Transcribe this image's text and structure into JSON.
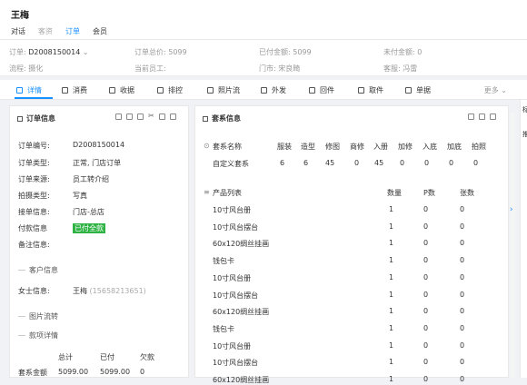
{
  "header": {
    "customer_name": "王梅",
    "tabs": [
      {
        "label": "对话",
        "state": "normal"
      },
      {
        "label": "客资",
        "state": "muted"
      },
      {
        "label": "订单",
        "state": "active"
      },
      {
        "label": "会员",
        "state": "normal"
      }
    ]
  },
  "order_info_bar": {
    "order_label": "订单:",
    "order_value": "D2008150014",
    "total_label": "订单总价:",
    "total_value": "5099",
    "paid_label": "已付金额:",
    "paid_value": "5099",
    "unpaid_label": "未付金额:",
    "unpaid_value": "0",
    "flow_label": "流程:",
    "flow_value": "摄化",
    "staff_label": "当前员工:",
    "staff_value": "",
    "store_label": "门市:",
    "store_value": "宋良畸",
    "service_label": "客服:",
    "service_value": "冯雷"
  },
  "actions": [
    "详情",
    "消费",
    "收据",
    "排控",
    "照片流",
    "外发",
    "回件",
    "取件",
    "单据"
  ],
  "more_label": "更多",
  "left_panel": {
    "title": "订单信息",
    "fields": [
      {
        "label": "订单编号:",
        "value": "D2008150014"
      },
      {
        "label": "订单类型:",
        "value": "正常, 门店订单"
      },
      {
        "label": "订单来源:",
        "value": "员工转介绍"
      },
      {
        "label": "拍摄类型:",
        "value": "写真"
      },
      {
        "label": "接单信息:",
        "value": "门店-总店"
      },
      {
        "label": "付款信息",
        "value": "已付全款"
      },
      {
        "label": "备注信息:",
        "value": ""
      }
    ],
    "section_customer": "客户信息",
    "customer_label": "女士信息:",
    "customer_name": "王梅",
    "customer_phone": "(15658213651)",
    "section_photo": "图片流转",
    "section_payment": "款项详情",
    "pay_headers": [
      "总计",
      "已付",
      "欠款"
    ],
    "pay_row_label": "套系金额",
    "pay_values": [
      "5099.00",
      "5099.00",
      "0"
    ]
  },
  "right_panel": {
    "title": "套系信息",
    "package_headers": [
      "套系名称",
      "服装",
      "造型",
      "修图",
      "商修",
      "入册",
      "加修",
      "入底",
      "加底",
      "拍照"
    ],
    "package_row": [
      "自定义套系",
      "6",
      "6",
      "45",
      "0",
      "45",
      "0",
      "0",
      "0",
      "0"
    ],
    "product_headers": [
      "产品列表",
      "数量",
      "P数",
      "张数"
    ],
    "products": [
      [
        "10寸风台册",
        "1",
        "0",
        "0"
      ],
      [
        "10寸风台摆台",
        "1",
        "0",
        "0"
      ],
      [
        "60x120绸丝挂画",
        "1",
        "0",
        "0"
      ],
      [
        "钱包卡",
        "1",
        "0",
        "0"
      ],
      [
        "10寸风台册",
        "1",
        "0",
        "0"
      ],
      [
        "10寸风台摆台",
        "1",
        "0",
        "0"
      ],
      [
        "60x120绸丝挂画",
        "1",
        "0",
        "0"
      ],
      [
        "钱包卡",
        "1",
        "0",
        "0"
      ],
      [
        "10寸风台册",
        "1",
        "0",
        "0"
      ],
      [
        "10寸风台摆台",
        "1",
        "0",
        "0"
      ],
      [
        "60x120绸丝挂画",
        "1",
        "0",
        "0"
      ]
    ]
  },
  "sidebar_labels": [
    "标",
    "推"
  ],
  "colors": {
    "accent": "#1890ff",
    "paid_badge": "#2fb344"
  }
}
